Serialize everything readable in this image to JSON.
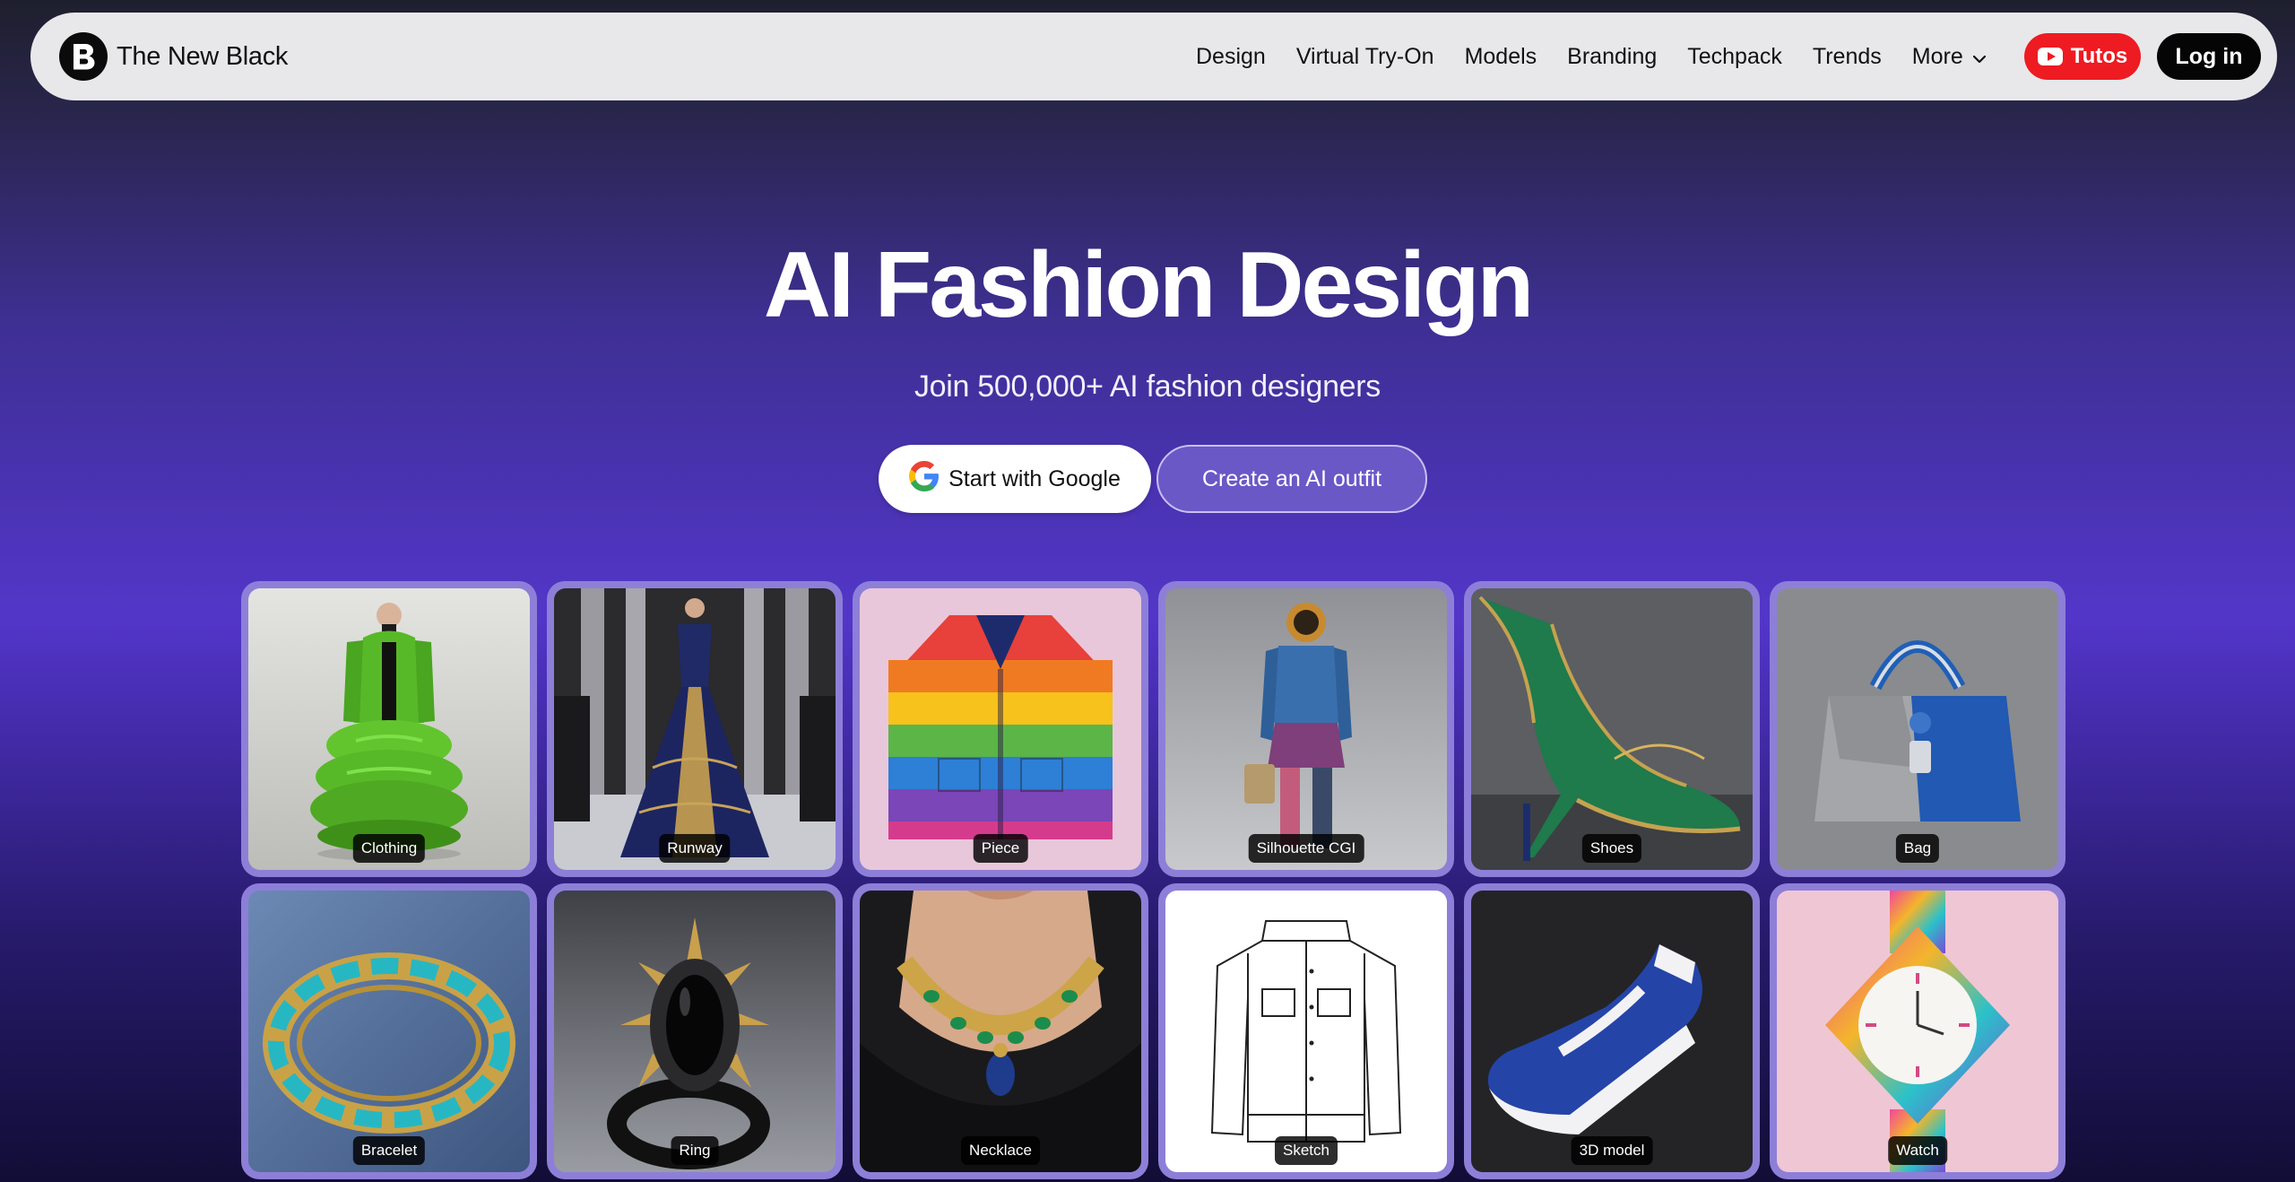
{
  "brand": {
    "name": "The New Black"
  },
  "nav": {
    "links": [
      "Design",
      "Virtual Try-On",
      "Models",
      "Branding",
      "Techpack",
      "Trends",
      "More"
    ],
    "tutos_label": "Tutos",
    "login_label": "Log in"
  },
  "hero": {
    "title": "AI Fashion Design",
    "subtitle": "Join 500,000+ AI fashion designers",
    "google_cta": "Start with Google",
    "outfit_cta": "Create an AI outfit"
  },
  "gallery": [
    {
      "label": "Clothing",
      "image": "green puffer coat model"
    },
    {
      "label": "Runway",
      "image": "navy gold gown on runway"
    },
    {
      "label": "Piece",
      "image": "rainbow striped coat"
    },
    {
      "label": "Silhouette CGI",
      "image": "astronaut helmet figure"
    },
    {
      "label": "Shoes",
      "image": "green winged high heel"
    },
    {
      "label": "Bag",
      "image": "grey and blue handbag"
    },
    {
      "label": "Bracelet",
      "image": "gold turquoise bracelet"
    },
    {
      "label": "Ring",
      "image": "black spiked ring"
    },
    {
      "label": "Necklace",
      "image": "gold emerald necklace"
    },
    {
      "label": "Sketch",
      "image": "jacket line drawing"
    },
    {
      "label": "3D model",
      "image": "blue white sneaker"
    },
    {
      "label": "Watch",
      "image": "iridescent watch"
    }
  ],
  "colors": {
    "accent_red": "#ee1b22",
    "tile_border": "#8d7fd8",
    "cta_purple": "#6a58c7"
  }
}
